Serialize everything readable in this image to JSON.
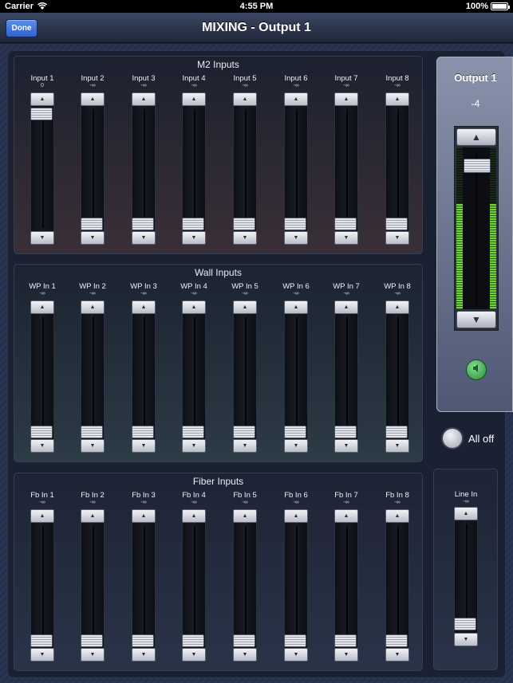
{
  "status_bar": {
    "carrier": "Carrier",
    "time": "4:55 PM",
    "battery": "100%"
  },
  "nav": {
    "title": "MIXING - Output 1",
    "done_label": "Done"
  },
  "groups": {
    "m2": {
      "title": "M2 Inputs",
      "channels": [
        {
          "label": "Input 1",
          "value": "0",
          "level": 0.88
        },
        {
          "label": "Input 2",
          "value": "-∞",
          "level": 0
        },
        {
          "label": "Input 3",
          "value": "-∞",
          "level": 0
        },
        {
          "label": "Input 4",
          "value": "-∞",
          "level": 0
        },
        {
          "label": "Input 5",
          "value": "-∞",
          "level": 0
        },
        {
          "label": "Input 6",
          "value": "-∞",
          "level": 0
        },
        {
          "label": "Input 7",
          "value": "-∞",
          "level": 0
        },
        {
          "label": "Input 8",
          "value": "-∞",
          "level": 0
        }
      ]
    },
    "wall": {
      "title": "Wall Inputs",
      "channels": [
        {
          "label": "WP In 1",
          "value": "-∞",
          "level": 0
        },
        {
          "label": "WP In 2",
          "value": "-∞",
          "level": 0
        },
        {
          "label": "WP In 3",
          "value": "-∞",
          "level": 0
        },
        {
          "label": "WP In 4",
          "value": "-∞",
          "level": 0
        },
        {
          "label": "WP In 5",
          "value": "-∞",
          "level": 0
        },
        {
          "label": "WP In 6",
          "value": "-∞",
          "level": 0
        },
        {
          "label": "WP In 7",
          "value": "-∞",
          "level": 0
        },
        {
          "label": "WP In 8",
          "value": "-∞",
          "level": 0
        }
      ]
    },
    "fiber": {
      "title": "Fiber Inputs",
      "channels": [
        {
          "label": "Fb In 1",
          "value": "-∞",
          "level": 0
        },
        {
          "label": "Fb In 2",
          "value": "-∞",
          "level": 0
        },
        {
          "label": "Fb In 3",
          "value": "-∞",
          "level": 0
        },
        {
          "label": "Fb In 4",
          "value": "-∞",
          "level": 0
        },
        {
          "label": "Fb In 5",
          "value": "-∞",
          "level": 0
        },
        {
          "label": "Fb In 6",
          "value": "-∞",
          "level": 0
        },
        {
          "label": "Fb In 7",
          "value": "-∞",
          "level": 0
        },
        {
          "label": "Fb In 8",
          "value": "-∞",
          "level": 0
        }
      ]
    }
  },
  "output": {
    "title": "Output 1",
    "value": "-4",
    "level": 0.93,
    "meter_level": 0.65
  },
  "all_off": {
    "label": "All off"
  },
  "line_in": {
    "label": "Line In",
    "value": "-∞",
    "level": 0
  },
  "colors": {
    "done_button": "#3a72dc",
    "meter_green": "#6fd62f",
    "speaker_green": "#3fae4e"
  },
  "icons": {
    "up": "triangle-up-icon",
    "down": "triangle-down-icon",
    "speaker": "speaker-icon",
    "wifi": "wifi-icon",
    "battery": "battery-icon"
  }
}
